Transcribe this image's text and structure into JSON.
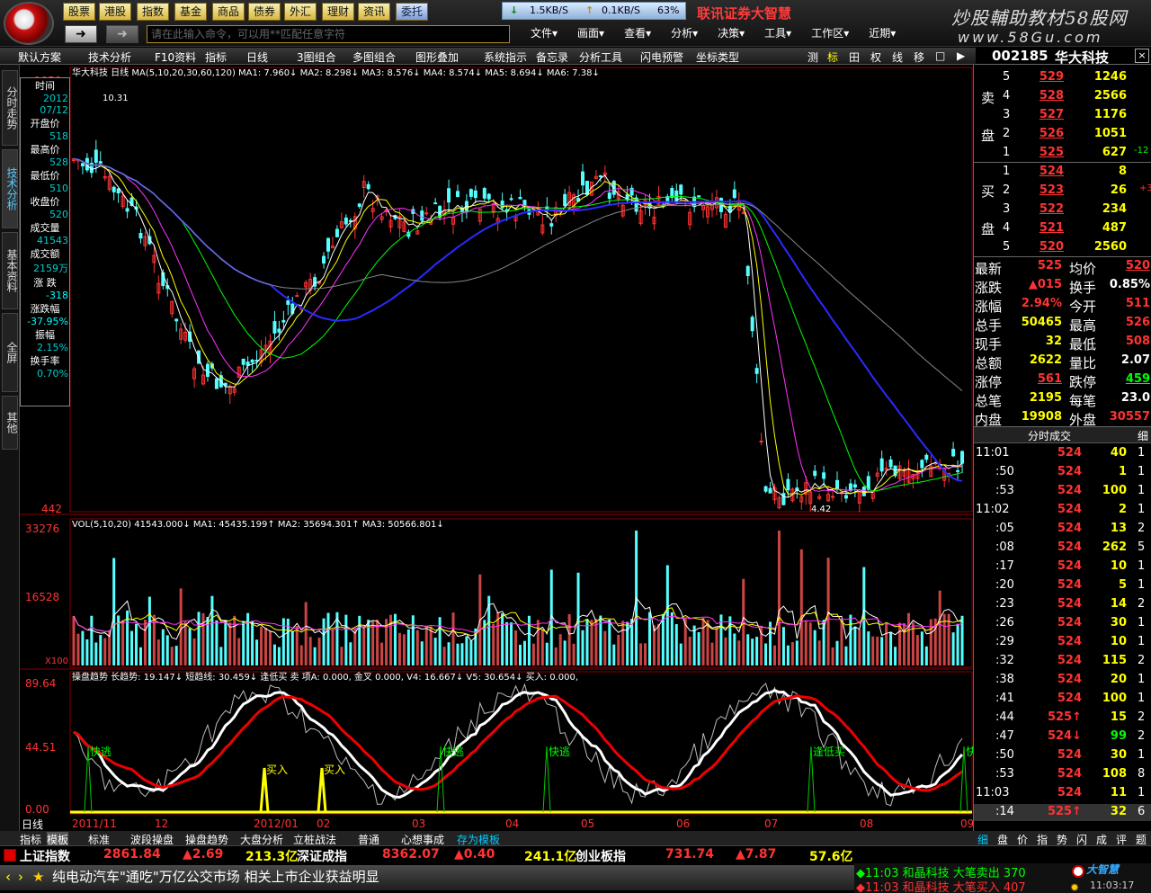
{
  "toolbar": {
    "buttons": [
      "股票",
      "港股",
      "指数",
      "基金",
      "商品",
      "债券",
      "外汇",
      "理财",
      "资讯",
      "委托"
    ],
    "command_placeholder": "请在此输入命令，可以用**匹配任意字符",
    "net": {
      "down": "1.5KB/S",
      "up": "0.1KB/S",
      "pct": "63%"
    },
    "menus": [
      "文件▾",
      "画面▾",
      "查看▾",
      "分析▾",
      "决策▾",
      "工具▾",
      "工作区▾",
      "近期▾"
    ],
    "brand": "联讯证券大智慧",
    "watermark1": "炒股輔助教材58股网",
    "watermark2": "www.58Gu.com"
  },
  "subbar": {
    "items": [
      "默认方案",
      "技术分析",
      "F10资料",
      "指标",
      "日线",
      "3图组合",
      "多图组合",
      "图形叠加",
      "系统指示",
      "备忘录",
      "分析工具",
      "闪电预警",
      "坐标类型"
    ],
    "right_icons": [
      "测",
      "标",
      "田",
      "权",
      "线",
      "移",
      "□",
      "▶"
    ]
  },
  "stock": {
    "code": "002185",
    "name": "华大科技",
    "period": "日线"
  },
  "left_tabs": [
    "分时走势",
    "技术分析",
    "基本资料",
    "全屏",
    "其他"
  ],
  "infobox": [
    {
      "label": "时间",
      "value": "2012"
    },
    {
      "label": "",
      "value": "07/12"
    },
    {
      "label": "开盘价",
      "value": "518"
    },
    {
      "label": "最高价",
      "value": "528"
    },
    {
      "label": "最低价",
      "value": "510"
    },
    {
      "label": "收盘价",
      "value": "520"
    },
    {
      "label": "成交量",
      "value": "41543"
    },
    {
      "label": "成交额",
      "value": "2159万"
    },
    {
      "label": "涨 跌",
      "value": "-318"
    },
    {
      "label": "涨跌幅",
      "value": "-37.95%"
    },
    {
      "label": "振幅",
      "value": "2.15%"
    },
    {
      "label": "换手率",
      "value": "0.70%"
    }
  ],
  "price_pane": {
    "ymax": "1050",
    "ymin": "442",
    "ma_header": "华大科技 日线  MA(5,10,20,30,60,120)  MA1: 7.960↓  MA2: 8.298↓  MA3: 8.576↓  MA4: 8.574↓  MA5: 8.694↓  MA6: 7.38↓",
    "hi_label": "10.31",
    "lo_label": "4.42"
  },
  "vol_pane": {
    "ymax": "33276",
    "ymid": "16528",
    "unit": "X100",
    "header": "VOL(5,10,20)  41543.000↓  MA1: 45435.199↑  MA2: 35694.301↑  MA3: 50566.801↓"
  },
  "osc_pane": {
    "ymax": "89.64",
    "ymid": "44.51",
    "ymin": "0.00",
    "header": "操盘趋势  长趋势: 19.147↓  短趋线: 30.459↓  逢低买  卖  项A: 0.000, 金叉  0.000, V4: 16.667↓  V5: 30.654↓  买入: 0.000,",
    "labels": [
      "快逃",
      "买入",
      "买入",
      "快逃",
      "快逃",
      "快逃",
      "逢低买"
    ],
    "dates": [
      "2011/11",
      "12",
      "2012/01",
      "02",
      "03",
      "04",
      "05",
      "06",
      "07",
      "08",
      "09"
    ],
    "period": "日线"
  },
  "bottom_tabs": [
    "指标",
    "模板",
    "标准",
    "波段操盘",
    "操盘趋势",
    "大盘分析",
    "立桩战法",
    "普通",
    "心想事成",
    "存为模板"
  ],
  "right_tabs": [
    "细",
    "盘",
    "价",
    "指",
    "势",
    "闪",
    "成",
    "评",
    "题"
  ],
  "order_book": {
    "sell": [
      {
        "lvl": "5",
        "price": "529",
        "vol": "1246",
        "chg": ""
      },
      {
        "lvl": "4",
        "price": "528",
        "vol": "2566",
        "chg": ""
      },
      {
        "lvl": "3",
        "price": "527",
        "vol": "1176",
        "chg": ""
      },
      {
        "lvl": "2",
        "price": "526",
        "vol": "1051",
        "chg": ""
      },
      {
        "lvl": "1",
        "price": "525",
        "vol": "627",
        "chg": "-12"
      }
    ],
    "buy": [
      {
        "lvl": "1",
        "price": "524",
        "vol": "8",
        "chg": ""
      },
      {
        "lvl": "2",
        "price": "523",
        "vol": "26",
        "chg": "+3"
      },
      {
        "lvl": "3",
        "price": "522",
        "vol": "234",
        "chg": ""
      },
      {
        "lvl": "4",
        "price": "521",
        "vol": "487",
        "chg": ""
      },
      {
        "lvl": "5",
        "price": "520",
        "vol": "2560",
        "chg": ""
      }
    ],
    "sell_label": [
      "卖",
      "盘"
    ],
    "buy_label": [
      "买",
      "盘"
    ]
  },
  "quote": [
    {
      "l1": "最新",
      "v1": "525",
      "l2": "均价",
      "v2": "520"
    },
    {
      "l1": "涨跌",
      "v1": "▲015",
      "l2": "换手",
      "v2": "0.85%"
    },
    {
      "l1": "涨幅",
      "v1": "2.94%",
      "l2": "今开",
      "v2": "511"
    },
    {
      "l1": "总手",
      "v1": "50465",
      "l2": "最高",
      "v2": "526"
    },
    {
      "l1": "现手",
      "v1": "32",
      "l2": "最低",
      "v2": "508"
    },
    {
      "l1": "总额",
      "v1": "2622",
      "l2": "量比",
      "v2": "2.07"
    },
    {
      "l1": "涨停",
      "v1": "561",
      "l2": "跌停",
      "v2": "459"
    },
    {
      "l1": "总笔",
      "v1": "2195",
      "l2": "每笔",
      "v2": "23.0"
    },
    {
      "l1": "内盘",
      "v1": "19908",
      "l2": "外盘",
      "v2": "30557"
    }
  ],
  "ticks_title": "分时成交",
  "ticks_tab": "细",
  "ticks": [
    {
      "t": "11:01",
      "p": "524",
      "v": "40",
      "n": "1"
    },
    {
      "t": ":50",
      "p": "524",
      "v": "1",
      "n": "1"
    },
    {
      "t": ":53",
      "p": "524",
      "v": "100",
      "n": "1"
    },
    {
      "t": "11:02",
      "p": "524",
      "v": "2",
      "n": "1"
    },
    {
      "t": ":05",
      "p": "524",
      "v": "13",
      "n": "2"
    },
    {
      "t": ":08",
      "p": "524",
      "v": "262",
      "n": "5"
    },
    {
      "t": ":17",
      "p": "524",
      "v": "10",
      "n": "1"
    },
    {
      "t": ":20",
      "p": "524",
      "v": "5",
      "n": "1"
    },
    {
      "t": ":23",
      "p": "524",
      "v": "14",
      "n": "2"
    },
    {
      "t": ":26",
      "p": "524",
      "v": "30",
      "n": "1"
    },
    {
      "t": ":29",
      "p": "524",
      "v": "10",
      "n": "1"
    },
    {
      "t": ":32",
      "p": "524",
      "v": "115",
      "n": "2"
    },
    {
      "t": ":38",
      "p": "524",
      "v": "20",
      "n": "1"
    },
    {
      "t": ":41",
      "p": "524",
      "v": "100",
      "n": "1"
    },
    {
      "t": ":44",
      "p": "525↑",
      "v": "15",
      "n": "2"
    },
    {
      "t": ":47",
      "p": "524↓",
      "v": "99",
      "n": "2"
    },
    {
      "t": ":50",
      "p": "524",
      "v": "30",
      "n": "1"
    },
    {
      "t": ":53",
      "p": "524",
      "v": "108",
      "n": "8"
    },
    {
      "t": "11:03",
      "p": "524",
      "v": "11",
      "n": "1"
    },
    {
      "t": ":14",
      "p": "525↑",
      "v": "32",
      "n": "6"
    }
  ],
  "indices": {
    "sh_name": "上证指数",
    "sh_val": "2861.84",
    "sh_chg": "▲2.69",
    "sh_amt": "213.3亿",
    "sz_name": "深证成指",
    "sz_val": "8362.07",
    "sz_chg": "▲0.40",
    "sz_amt": "241.1亿",
    "cy_name": "创业板指",
    "cy_val": "731.74",
    "cy_chg": "▲7.87",
    "cy_amt": "57.6亿"
  },
  "ticker_text": "纯电动汽车\"通吃\"万亿公交市场  相关上市企业获益明显",
  "alerts": [
    {
      "text": "◆11:03 和晶科技 大笔卖出 370"
    },
    {
      "text": "◆11:03 和晶科技 大笔买入 407"
    }
  ],
  "clock": "11:03:17",
  "colors": {
    "up": "#ff3333",
    "down": "#00ffff",
    "gold": "#ffff00"
  }
}
